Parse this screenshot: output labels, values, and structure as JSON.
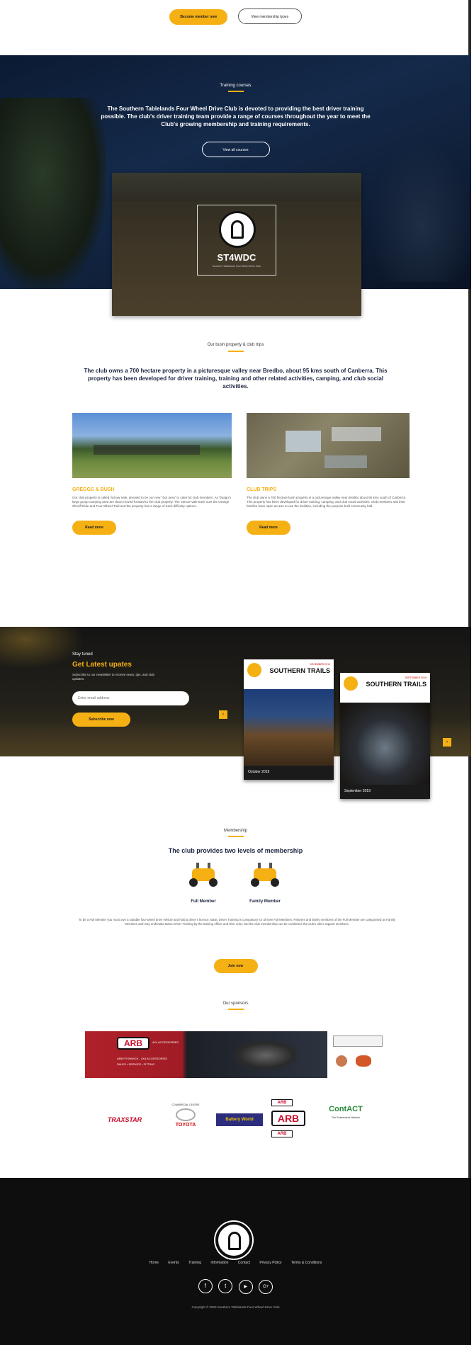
{
  "top_buttons": {
    "primary": "Become member now",
    "secondary": "View membership types"
  },
  "training": {
    "kicker": "Training courses",
    "heading": "The Southern Tablelands Four Wheel Drive Club is devoted to providing the best driver training possible. The club's driver training team provide a range of courses throughout the year to meet the Club's growing membership and training requirements.",
    "button": "View all courses",
    "logo_text": "ST4WDC",
    "logo_sub": "Southern Tablelands Four Wheel Drive Club"
  },
  "property": {
    "kicker": "Our bush property & club trips",
    "heading": "The club owns a 700 hectare property in a picturesque valley near Bredbo, about 95 kms south of Canberra. This property has been developed for driver training, training and other related activities, camping, and club social activities.",
    "cards": [
      {
        "title": "GREGGS & BUSH",
        "text": "Our club property is called Yarrow Vale, devoted to be our new “4x4 area” to cater for club members. As Tarago's large group camping area are down moved forward to the club property. The Yarrow Vale track outs the Orange Sheriff Ride and Four Wheel Trail and the property has a range of track difficulty options.",
        "button": "Read more"
      },
      {
        "title": "CLUB TRIPS",
        "text": "The club owns a 700 hectare bush property in a picturesque valley near Bredbo about 95 kms south of Canberra. This property has been developed for driver training, camping, and club social activities. Club members and their families have open access to use the facilities, including the purpose built community hall.",
        "button": "Read more"
      }
    ]
  },
  "newsletter": {
    "kicker": "Stay tuned",
    "heading": "Get Latest upates",
    "text": "Subscribe to our newsletter to receive news, tips, and club updates.",
    "placeholder": "Enter email address",
    "button": "Subscribe now",
    "cards": [
      {
        "title": "SOUTHERN TRAILS",
        "date_top": "DECEMBER 2019",
        "caption": "October 2019"
      },
      {
        "title": "SOUTHERN TRAILS",
        "date_top": "SEPTEMBER 2019",
        "caption": "September 2019"
      }
    ]
  },
  "membership": {
    "kicker": "Membership",
    "heading": "The club provides two levels of membership",
    "types": [
      {
        "label": "Full Member"
      },
      {
        "label": "Family Member"
      }
    ],
    "text": "To be a Full Member you must own a suitable four-wheel drive vehicle and hold a driver's licence. Basic Driver Training is compulsory for all new Full Members. Partners and family members of the Full Member are categorised as Family Members and may undertake Basic Driver Training by the training officer and their entry into the club membership can be combined, the club's other support members.",
    "button": "Join now"
  },
  "sponsors": {
    "kicker": "Our sponsors",
    "banner_brand": "ARB",
    "banner_sub": "4X4 ACCESSORIES",
    "banner_line1": "ARB FYSHWICK - 4X4 ACCESSORIES",
    "banner_line2": "SALES • SERVICE • FITTING",
    "logos": [
      {
        "name": "TRAXSTAR",
        "kind": "text"
      },
      {
        "name": "TOYOTA",
        "top": "COMMERCIAL CENTRE",
        "kind": "toyota"
      },
      {
        "name": "Battery World",
        "kind": "battery"
      },
      {
        "name": "ARB",
        "kind": "arb"
      },
      {
        "name": "ContACT",
        "sub": "The Professional Network",
        "kind": "contact"
      }
    ]
  },
  "footer": {
    "nav": [
      "Home",
      "Events",
      "Training",
      "Information",
      "Contact",
      "Privacy Policy",
      "Terms & Conditions"
    ],
    "social": [
      {
        "icon": "facebook-icon",
        "glyph": "f"
      },
      {
        "icon": "twitter-icon",
        "glyph": "t"
      },
      {
        "icon": "youtube-icon",
        "glyph": "▶"
      },
      {
        "icon": "google-plus-icon",
        "glyph": "G+"
      }
    ],
    "copyright": "Copyright © 2020 Southern Tablelands Four Wheel Drive Club"
  },
  "colors": {
    "accent": "#f5b014",
    "navy": "#1b2440",
    "footer": "#0e0e0e"
  }
}
